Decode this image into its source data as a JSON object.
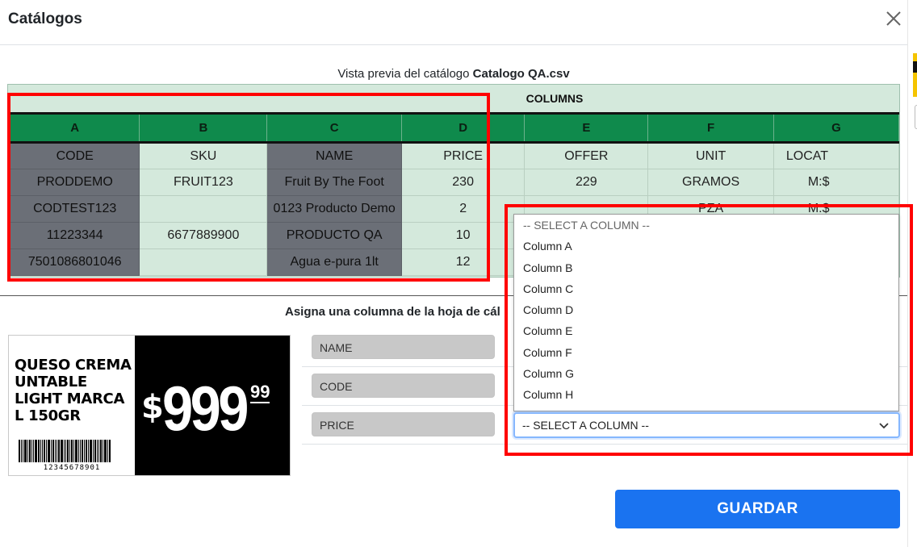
{
  "modal": {
    "title": "Catálogos",
    "close_icon": "close-icon"
  },
  "preview": {
    "caption_prefix": "Vista previa del catálogo",
    "file_name": "Catalogo QA.csv",
    "columns_label": "COLUMNS",
    "headers": [
      "A",
      "B",
      "C",
      "D",
      "E",
      "F",
      "G"
    ],
    "rows": [
      [
        "CODE",
        "SKU",
        "NAME",
        "PRICE",
        "OFFER",
        "UNIT",
        "LOCAT"
      ],
      [
        "PRODDEMO",
        "FRUIT123",
        "Fruit By The Foot",
        "230",
        "229",
        "GRAMOS",
        "M:$"
      ],
      [
        "CODTEST123",
        "",
        "0123 Producto Demo",
        "2",
        "",
        "PZA",
        "M:$"
      ],
      [
        "11223344",
        "6677889900",
        "PRODUCTO QA",
        "10",
        "",
        "",
        ""
      ],
      [
        "7501086801046",
        "",
        "Agua e-pura 1lt",
        "12",
        "",
        "",
        ""
      ]
    ]
  },
  "assign": {
    "text": "Asigna una columna de la hoja de cál"
  },
  "price_tag": {
    "product_name": "QUESO CREMA UNTABLE LIGHT MARCA L 150GR",
    "currency": "$",
    "price": "999",
    "cents": "99",
    "barcode_number": "12345678901"
  },
  "fields": [
    {
      "label": "NAME"
    },
    {
      "label": "CODE"
    },
    {
      "label": "PRICE"
    }
  ],
  "dropdown": {
    "selected": "-- SELECT A COLUMN --",
    "options": [
      "-- SELECT A COLUMN --",
      "Column A",
      "Column B",
      "Column C",
      "Column D",
      "Column E",
      "Column F",
      "Column G",
      "Column H"
    ]
  },
  "actions": {
    "save_label": "GUARDAR"
  },
  "colors": {
    "header_green": "#0f8a4c",
    "preview_bg": "#d4e9dc",
    "dark_cell": "#6b6f77",
    "primary_blue": "#1a73f0",
    "highlight_red": "#ff0000"
  }
}
